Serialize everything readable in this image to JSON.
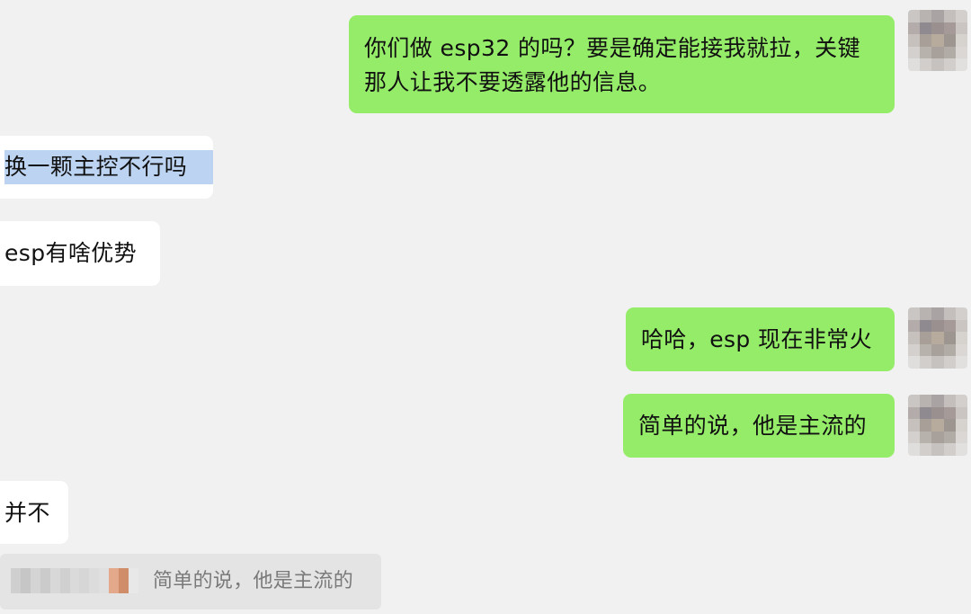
{
  "messages": [
    {
      "direction": "outgoing",
      "line1": "你们做 esp32 的吗？要是确定能接我就拉，关键",
      "line2": "那人让我不要透露他的信息。"
    },
    {
      "direction": "incoming",
      "text": "换一颗主控不行吗",
      "selected": true
    },
    {
      "direction": "incoming",
      "text": "esp有啥优势"
    },
    {
      "direction": "outgoing",
      "text": "哈哈，esp 现在非常火"
    },
    {
      "direction": "outgoing",
      "text": "简单的说，他是主流的"
    },
    {
      "direction": "incoming",
      "text": "并不"
    }
  ],
  "quote": {
    "text": "简单的说，他是主流的"
  },
  "colors": {
    "background": "#f1f1f1",
    "outgoing_bubble": "#95ec69",
    "incoming_bubble": "#ffffff",
    "selection": "#bcd3f1",
    "quote_background": "#e4e4e4"
  },
  "icons": {
    "avatar": "pixelated-avatar-icon"
  }
}
